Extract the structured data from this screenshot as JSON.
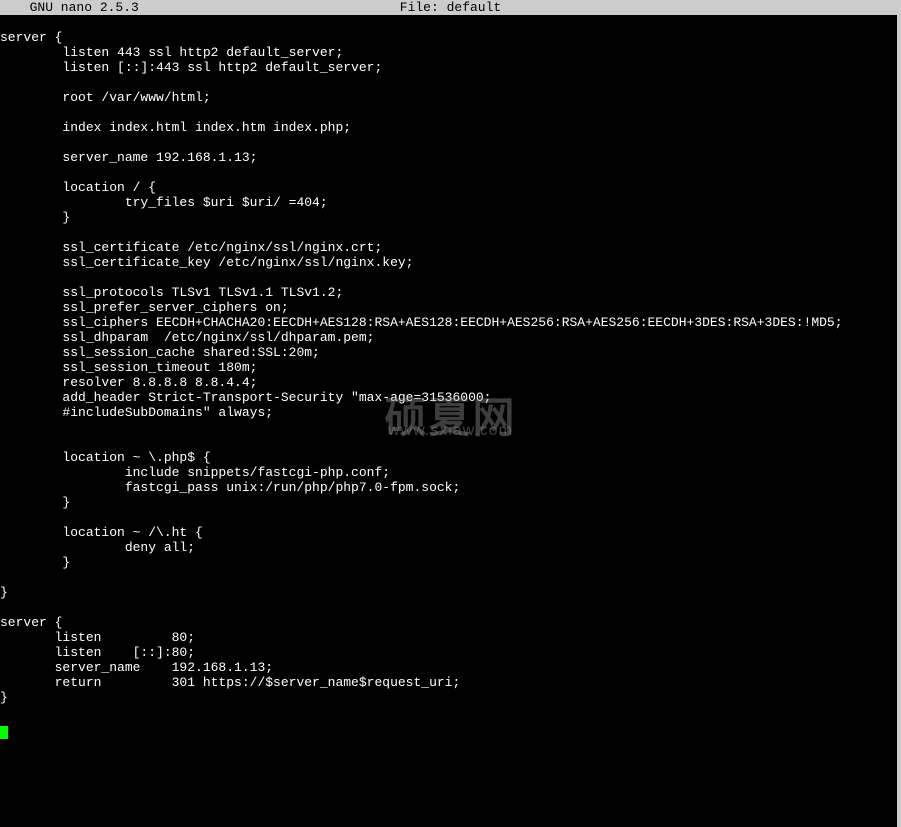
{
  "titlebar": {
    "app": "  GNU nano 2.5.3",
    "file_label": "File: default"
  },
  "file": {
    "lines": [
      "server {",
      "        listen 443 ssl http2 default_server;",
      "        listen [::]:443 ssl http2 default_server;",
      "",
      "        root /var/www/html;",
      "",
      "        index index.html index.htm index.php;",
      "",
      "        server_name 192.168.1.13;",
      "",
      "        location / {",
      "                try_files $uri $uri/ =404;",
      "        }",
      "",
      "        ssl_certificate /etc/nginx/ssl/nginx.crt;",
      "        ssl_certificate_key /etc/nginx/ssl/nginx.key;",
      "",
      "        ssl_protocols TLSv1 TLSv1.1 TLSv1.2;",
      "        ssl_prefer_server_ciphers on;",
      "        ssl_ciphers EECDH+CHACHA20:EECDH+AES128:RSA+AES128:EECDH+AES256:RSA+AES256:EECDH+3DES:RSA+3DES:!MD5;",
      "        ssl_dhparam  /etc/nginx/ssl/dhparam.pem;",
      "        ssl_session_cache shared:SSL:20m;",
      "        ssl_session_timeout 180m;",
      "        resolver 8.8.8.8 8.8.4.4;",
      "        add_header Strict-Transport-Security \"max-age=31536000;",
      "        #includeSubDomains\" always;",
      "",
      "",
      "        location ~ \\.php$ {",
      "                include snippets/fastcgi-php.conf;",
      "                fastcgi_pass unix:/run/php/php7.0-fpm.sock;",
      "        }",
      "",
      "        location ~ /\\.ht {",
      "                deny all;",
      "        }",
      "",
      "}",
      "",
      "server {",
      "       listen         80;",
      "       listen    [::]:80;",
      "       server_name    192.168.1.13;",
      "       return         301 https://$server_name$request_uri;",
      "}",
      ""
    ]
  },
  "watermark": {
    "big": "硕夏网",
    "small": "www.sxiaw.com"
  }
}
